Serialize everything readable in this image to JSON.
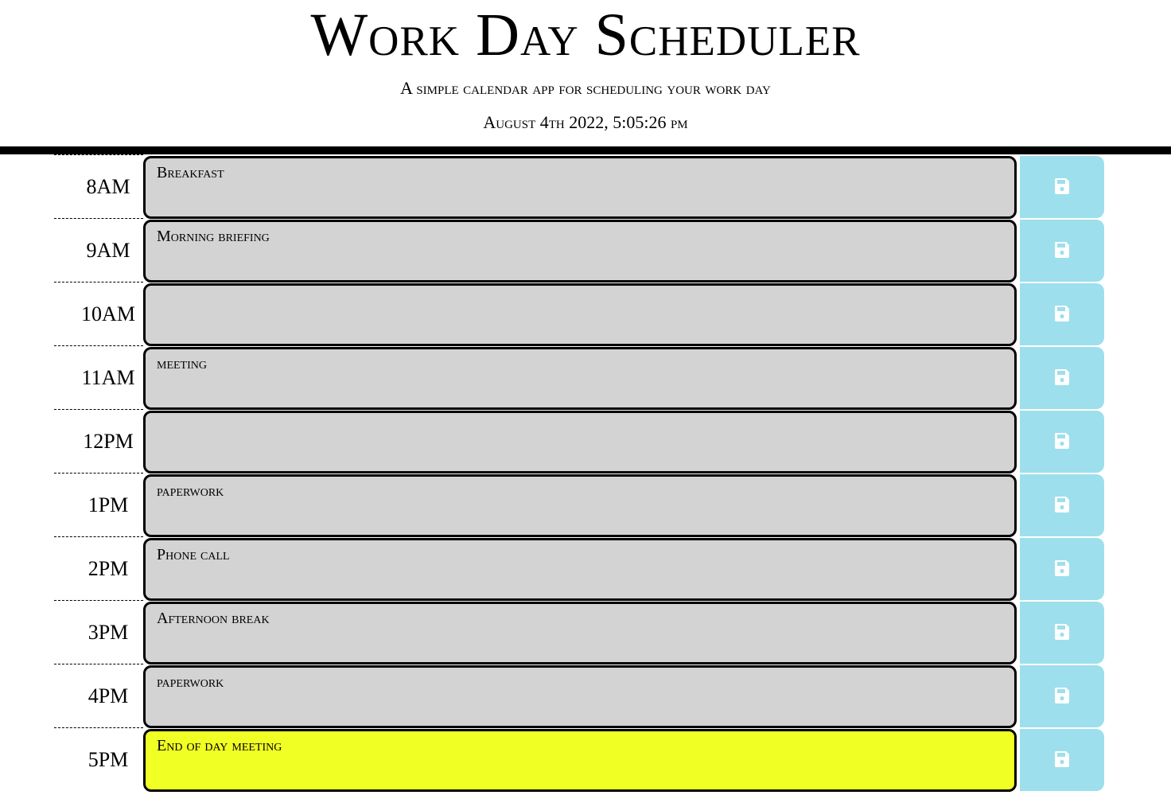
{
  "header": {
    "title": "Work Day Scheduler",
    "subtitle": "A simple calendar app for scheduling your work day",
    "current_datetime": "August 4th 2022, 5:05:26 pm"
  },
  "rows": [
    {
      "hour": "8AM",
      "text": "Breakfast",
      "state": "past"
    },
    {
      "hour": "9AM",
      "text": "Morning briefing",
      "state": "past"
    },
    {
      "hour": "10AM",
      "text": "",
      "state": "past"
    },
    {
      "hour": "11AM",
      "text": "meeting",
      "state": "past"
    },
    {
      "hour": "12PM",
      "text": "",
      "state": "past"
    },
    {
      "hour": "1PM",
      "text": "paperwork",
      "state": "past"
    },
    {
      "hour": "2PM",
      "text": "Phone call",
      "state": "past"
    },
    {
      "hour": "3PM",
      "text": "Afternoon break",
      "state": "past"
    },
    {
      "hour": "4PM",
      "text": "paperwork",
      "state": "past"
    },
    {
      "hour": "5PM",
      "text": "End of day meeting",
      "state": "present"
    }
  ],
  "icons": {
    "save": "floppy-disk-icon"
  },
  "colors": {
    "past": "#d3d3d3",
    "present": "#f0ff24",
    "save_button": "#9ddfec",
    "save_icon": "#ffffff"
  }
}
